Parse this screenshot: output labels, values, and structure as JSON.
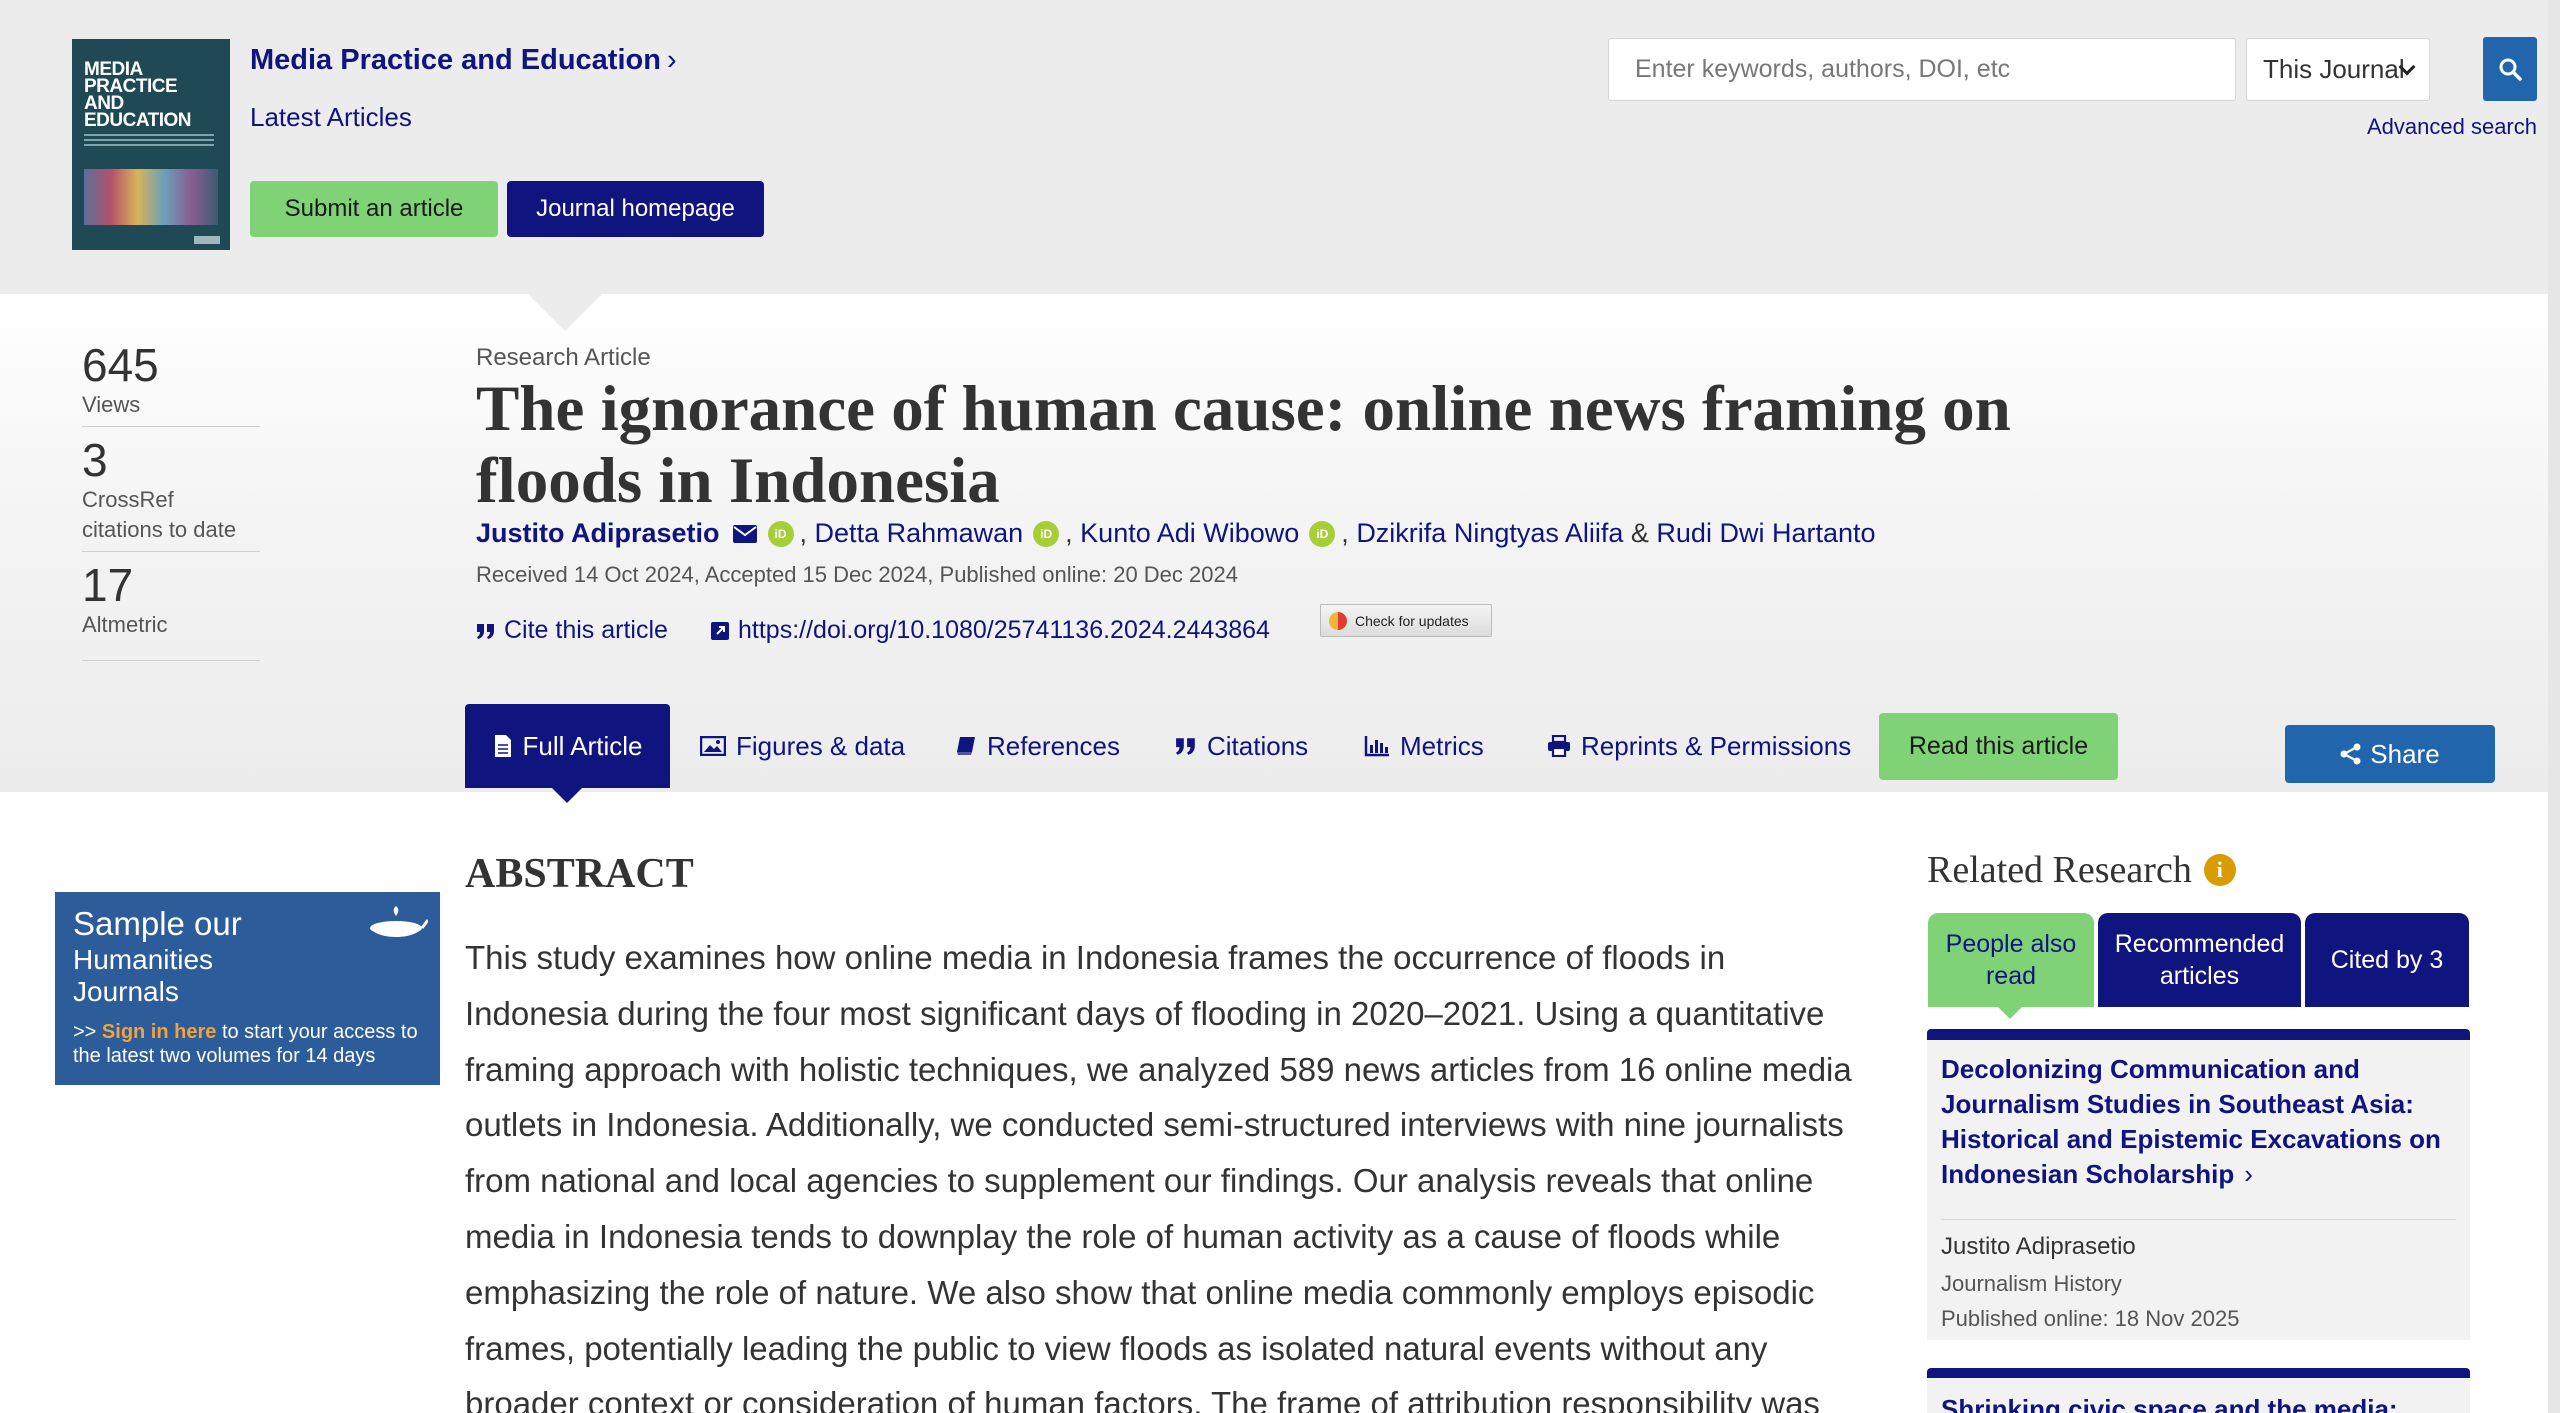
{
  "header": {
    "cover_title": "MEDIA\nPRACTICE\nAND\nEDUCATION",
    "journal_name": "Media Practice and Education",
    "latest_articles": "Latest Articles",
    "submit_label": "Submit an article",
    "journal_homepage_label": "Journal homepage"
  },
  "search": {
    "placeholder": "Enter keywords, authors, DOI, etc",
    "scope": "This Journal",
    "advanced": "Advanced search"
  },
  "stats": [
    {
      "value": "645",
      "label": "Views"
    },
    {
      "value": "3",
      "label": "CrossRef citations to date"
    },
    {
      "value": "17",
      "label": "Altmetric"
    }
  ],
  "article": {
    "type": "Research Article",
    "title": "The ignorance of human cause: online news framing on floods in Indonesia",
    "authors": [
      "Justito Adiprasetio",
      "Detta Rahmawan",
      "Kunto Adi Wibowo",
      "Dzikrifa Ningtyas Aliifa",
      "Rudi Dwi Hartanto"
    ],
    "dates": "Received 14 Oct 2024, Accepted 15 Dec 2024, Published online: 20 Dec 2024",
    "cite_label": "Cite this article",
    "doi": "https://doi.org/10.1080/25741136.2024.2443864",
    "check_updates": "Check for updates"
  },
  "tabs": {
    "full_article": "Full Article",
    "figures": "Figures & data",
    "references": "References",
    "citations": "Citations",
    "metrics": "Metrics",
    "reprints": "Reprints & Permissions",
    "read": "Read this article",
    "share": "Share"
  },
  "ad": {
    "line1": "Sample our",
    "line2": "Humanities\nJournals",
    "prefix": ">> ",
    "link": "Sign in here",
    "body": " to start your access to the latest two volumes for 14 days"
  },
  "abstract": {
    "heading": "ABSTRACT",
    "text": "This study examines how online media in Indonesia frames the occurrence of floods in Indonesia during the four most significant days of flooding in 2020–2021. Using a quantitative framing approach with holistic techniques, we analyzed 589 news articles from 16 online media outlets in Indonesia. Additionally, we conducted semi-structured interviews with nine journalists from national and local agencies to supplement our findings. Our analysis reveals that online media in Indonesia tends to downplay the role of human activity as a cause of floods while emphasizing the role of nature. We also show that online media commonly employs episodic frames, potentially leading the public to view floods as isolated natural events without any broader context or consideration of human factors. The frame of attribution responsibility was"
  },
  "related": {
    "title": "Related Research",
    "tabs": [
      "People also read",
      "Recommended articles",
      "Cited by 3"
    ],
    "items": [
      {
        "title": "Decolonizing Communication and Journalism Studies in Southeast Asia: Historical and Epistemic Excavations on Indonesian Scholarship",
        "author": "Justito Adiprasetio",
        "journal": "Journalism History",
        "published": "Published online: 18 Nov 2025"
      },
      {
        "title": "Shrinking civic space and the media: How"
      }
    ]
  },
  "colors": {
    "navy": "#10147e",
    "green": "#80d276",
    "blue": "#2165ad",
    "orcid": "#a6ce39"
  }
}
